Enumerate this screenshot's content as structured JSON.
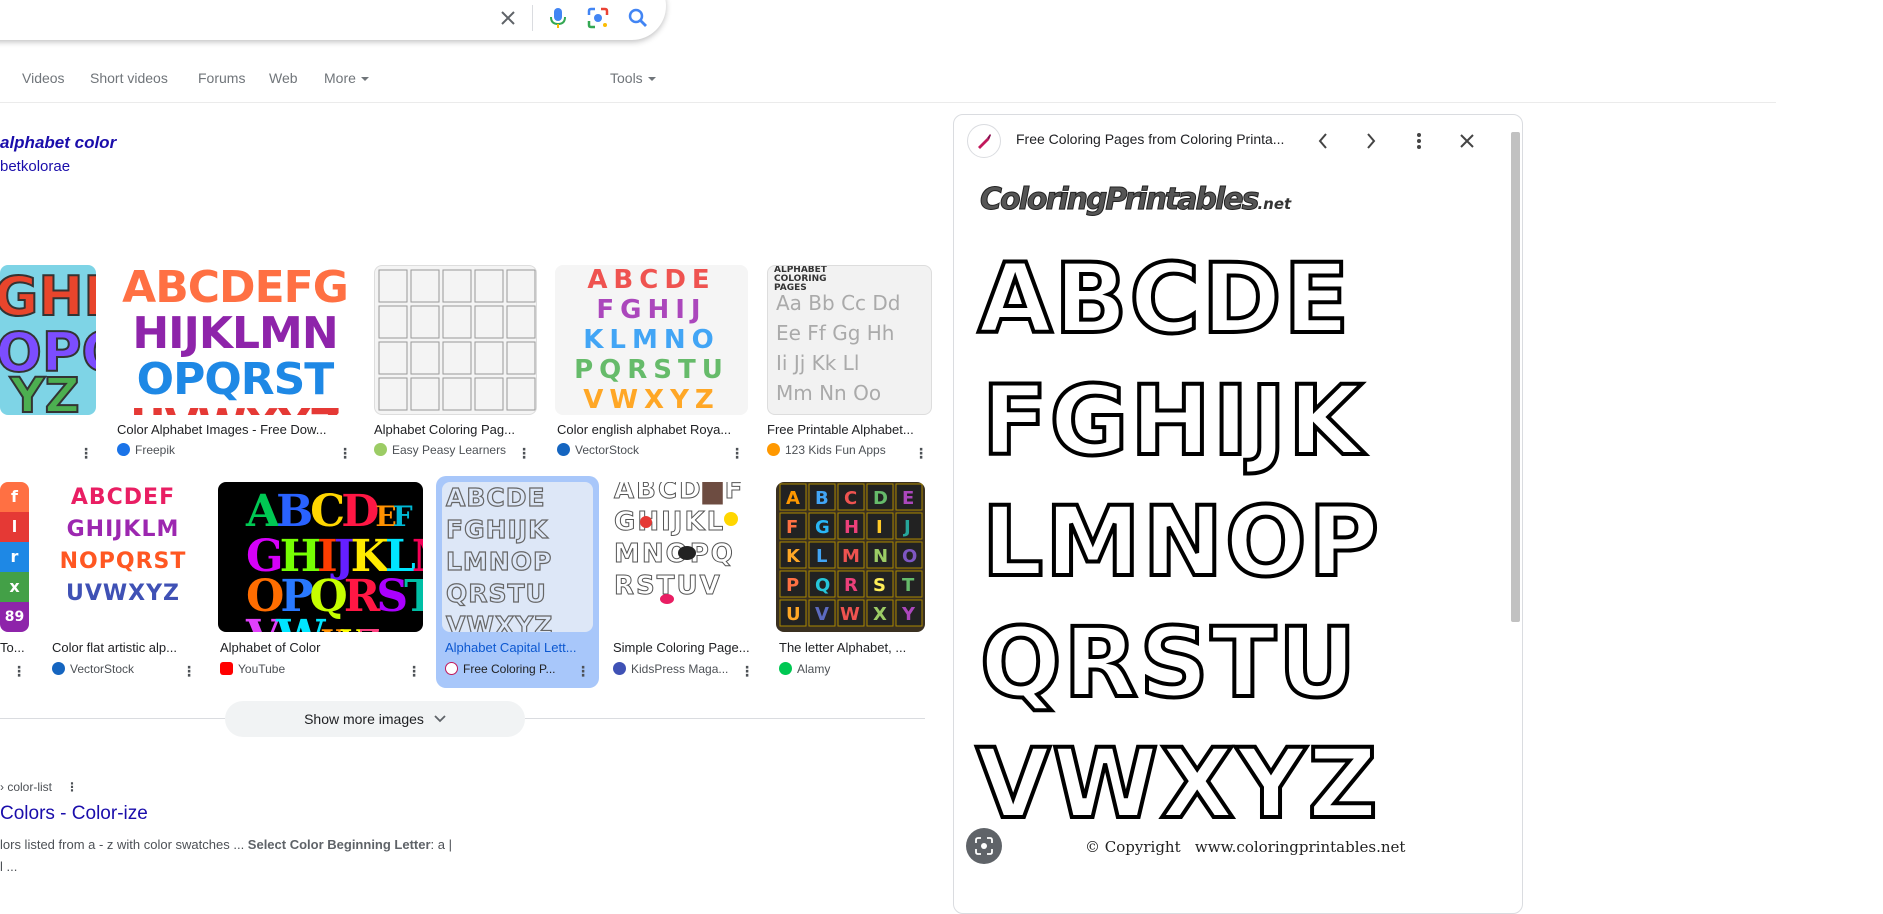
{
  "search": {
    "value": ""
  },
  "tabs": [
    {
      "label": "Videos"
    },
    {
      "label": "Short videos"
    },
    {
      "label": "Forums"
    },
    {
      "label": "Web"
    },
    {
      "label": "More"
    }
  ],
  "tools_label": "Tools",
  "heading": {
    "title": "alphabet color",
    "subtitle": "betkolorae"
  },
  "images_row1": [
    {
      "caption": "",
      "source": ""
    },
    {
      "caption": "Color Alphabet Images - Free Dow...",
      "source": "Freepik"
    },
    {
      "caption": "Alphabet Coloring Pag...",
      "source": "Easy Peasy Learners"
    },
    {
      "caption": "Color english alphabet Roya...",
      "source": "VectorStock"
    },
    {
      "caption": "Free Printable Alphabet...",
      "source": "123 Kids Fun Apps"
    }
  ],
  "images_row2": [
    {
      "caption": "To...",
      "source": ""
    },
    {
      "caption": "Color flat artistic alp...",
      "source": "VectorStock"
    },
    {
      "caption": "Alphabet of Color",
      "source": "YouTube"
    },
    {
      "caption": "Alphabet Capital Lett...",
      "source": "Free Coloring P..."
    },
    {
      "caption": "Simple Coloring Page...",
      "source": "KidsPress Maga..."
    },
    {
      "caption": "The letter Alphabet, ...",
      "source": "Alamy"
    }
  ],
  "show_more_label": "Show more images",
  "result": {
    "crumb": "› color-list",
    "title": "Colors - Color-ize",
    "snippet_a": "lors listed from a - z with color swatches ... ",
    "snippet_bold": "Select Color Beginning Letter",
    "snippet_b": ": a |",
    "snippet_line2": "l ..."
  },
  "panel": {
    "title": "Free Coloring Pages from Coloring Printa...",
    "logo_text": "ColoringPrintables",
    "logo_suffix": ".net",
    "letter_rows": [
      "ABCDE",
      "FGHIJK",
      "LMNOP",
      "QRSTU",
      "VWXYZ"
    ],
    "copyright": "© Copyright   www.coloringprintables.net"
  },
  "thumb_texts": {
    "r1_1": [
      "ABCDEFG",
      "HIJKLMN",
      "OPQRST",
      "UVWXYZ"
    ],
    "r1_3": [
      "ABCDE",
      "FGHIJ",
      "KLMNO",
      "PQRSTU",
      "VWXYZ"
    ],
    "r1_4_header": "ALPHABET COLORING PAGES",
    "r1_4_rows": [
      "Aa Bb Cc Dd",
      "Ee Ff Gg Hh",
      "Ii Jj Kk Ll",
      "Mm Nn Oo"
    ],
    "r2_1": [
      "ABCDEF",
      "GHIJKLM",
      "NOPQRST",
      "UVWXYZ"
    ],
    "r2_3": [
      "ABCDE",
      "FGHIJK",
      "LMNOP",
      "QRSTU",
      "VWXYZ"
    ]
  },
  "colors": {
    "link": "#1a0dab",
    "selected_bg": "#a8c7fa"
  }
}
